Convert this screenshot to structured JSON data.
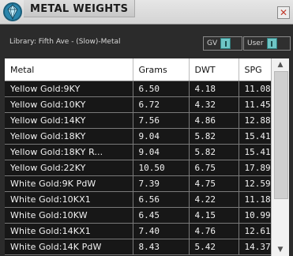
{
  "window": {
    "title": "METAL WEIGHTS",
    "close_glyph": "✕"
  },
  "library": {
    "label": "Library: Fifth Ave - (Slow)-Metal",
    "toggles": [
      {
        "label": "GV",
        "state": "on"
      },
      {
        "label": "User",
        "state": "on"
      }
    ]
  },
  "table": {
    "columns": [
      "Metal",
      "Grams",
      "DWT",
      "SPG"
    ],
    "rows": [
      [
        "Yellow Gold:9KY",
        "6.50",
        "4.18",
        "11.08"
      ],
      [
        "Yellow Gold:10KY",
        "6.72",
        "4.32",
        "11.45"
      ],
      [
        "Yellow Gold:14KY",
        "7.56",
        "4.86",
        "12.88"
      ],
      [
        "Yellow Gold:18KY",
        "9.04",
        "5.82",
        "15.41"
      ],
      [
        "Yellow Gold:18KY R...",
        "9.04",
        "5.82",
        "15.41"
      ],
      [
        "Yellow Gold:22KY",
        "10.50",
        "6.75",
        "17.89"
      ],
      [
        "White Gold:9K PdW",
        "7.39",
        "4.75",
        "12.59"
      ],
      [
        "White Gold:10KX1",
        "6.56",
        "4.22",
        "11.18"
      ],
      [
        "White Gold:10KW",
        "6.45",
        "4.15",
        "10.99"
      ],
      [
        "White Gold:14KX1",
        "7.40",
        "4.76",
        "12.61"
      ],
      [
        "White Gold:14K PdW",
        "8.43",
        "5.42",
        "14.37"
      ]
    ]
  },
  "colors": {
    "accent": "#6ec6c6",
    "table_bg": "#171717",
    "header_bg": "#ffffff"
  },
  "icons": {
    "app": "diamond-ring-icon",
    "close": "close-icon",
    "scroll_up": "chevron-up-icon",
    "scroll_down": "chevron-down-icon"
  }
}
